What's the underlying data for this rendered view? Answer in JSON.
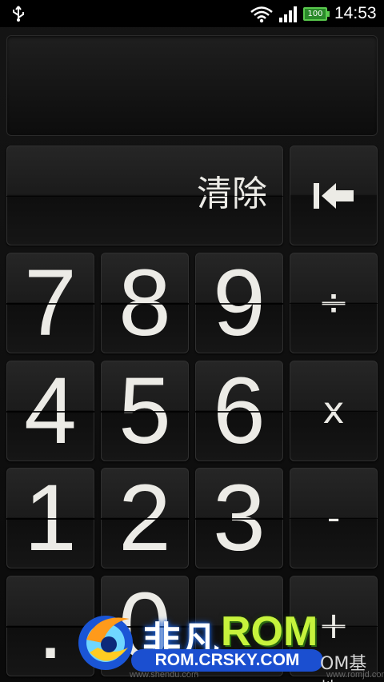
{
  "status_bar": {
    "time": "14:53",
    "battery": "100",
    "icons": [
      "usb-icon",
      "wifi-icon",
      "signal-icon",
      "battery-icon"
    ]
  },
  "display": {
    "value": ""
  },
  "keys": {
    "clear": "清除",
    "backspace_icon": "backspace-icon",
    "row1": [
      "7",
      "8",
      "9"
    ],
    "row2": [
      "4",
      "5",
      "6"
    ],
    "row3": [
      "1",
      "2",
      "3"
    ],
    "row4": [
      ".",
      "0"
    ],
    "divide": "÷",
    "multiply": "x",
    "minus": "-",
    "plus": "+"
  },
  "watermark": {
    "logo": "crsky-logo",
    "cn_name": "非凡",
    "rom": "ROM",
    "url": "ROM.CRSKY.COM",
    "small_left": "www.shendu.com",
    "small_right": "www.romjd.com",
    "right_text": "OM基地"
  },
  "colors": {
    "key_text": "#ecebe6",
    "background": "#0d0d0d",
    "battery": "#5ac94e"
  }
}
